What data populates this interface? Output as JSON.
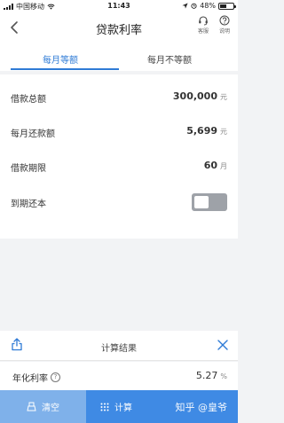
{
  "status_bar": {
    "carrier": "中国移动",
    "time": "11:43",
    "battery_percent": "48%",
    "battery_level": 0.48
  },
  "header": {
    "title": "贷款利率",
    "service_label": "客服",
    "help_label": "说明"
  },
  "tabs": [
    {
      "label": "每月等额",
      "active": true
    },
    {
      "label": "每月不等额",
      "active": false
    }
  ],
  "form": {
    "rows": [
      {
        "label": "借款总额",
        "value": "300,000",
        "unit": "元"
      },
      {
        "label": "每月还款额",
        "value": "5,699",
        "unit": "元"
      },
      {
        "label": "借款期限",
        "value": "60",
        "unit": "月"
      },
      {
        "label": "到期还本",
        "toggle_on": false
      }
    ]
  },
  "result": {
    "title": "计算结果",
    "label": "年化利率",
    "help_glyph": "?",
    "value": "5.27",
    "unit": "%"
  },
  "bottom": {
    "clear_label": "清空",
    "calc_label": "计算",
    "watermark": "知乎 @皇爷"
  },
  "colors": {
    "accent": "#2f7bd6",
    "button_light": "#7fb1ea",
    "button_dark": "#3f8ae4",
    "toggle_off": "#9ea2a8"
  },
  "icons": [
    "signal-icon",
    "wifi-icon",
    "back-icon",
    "headset-icon",
    "question-icon",
    "share-icon",
    "close-icon",
    "eraser-icon",
    "calculator-icon"
  ]
}
